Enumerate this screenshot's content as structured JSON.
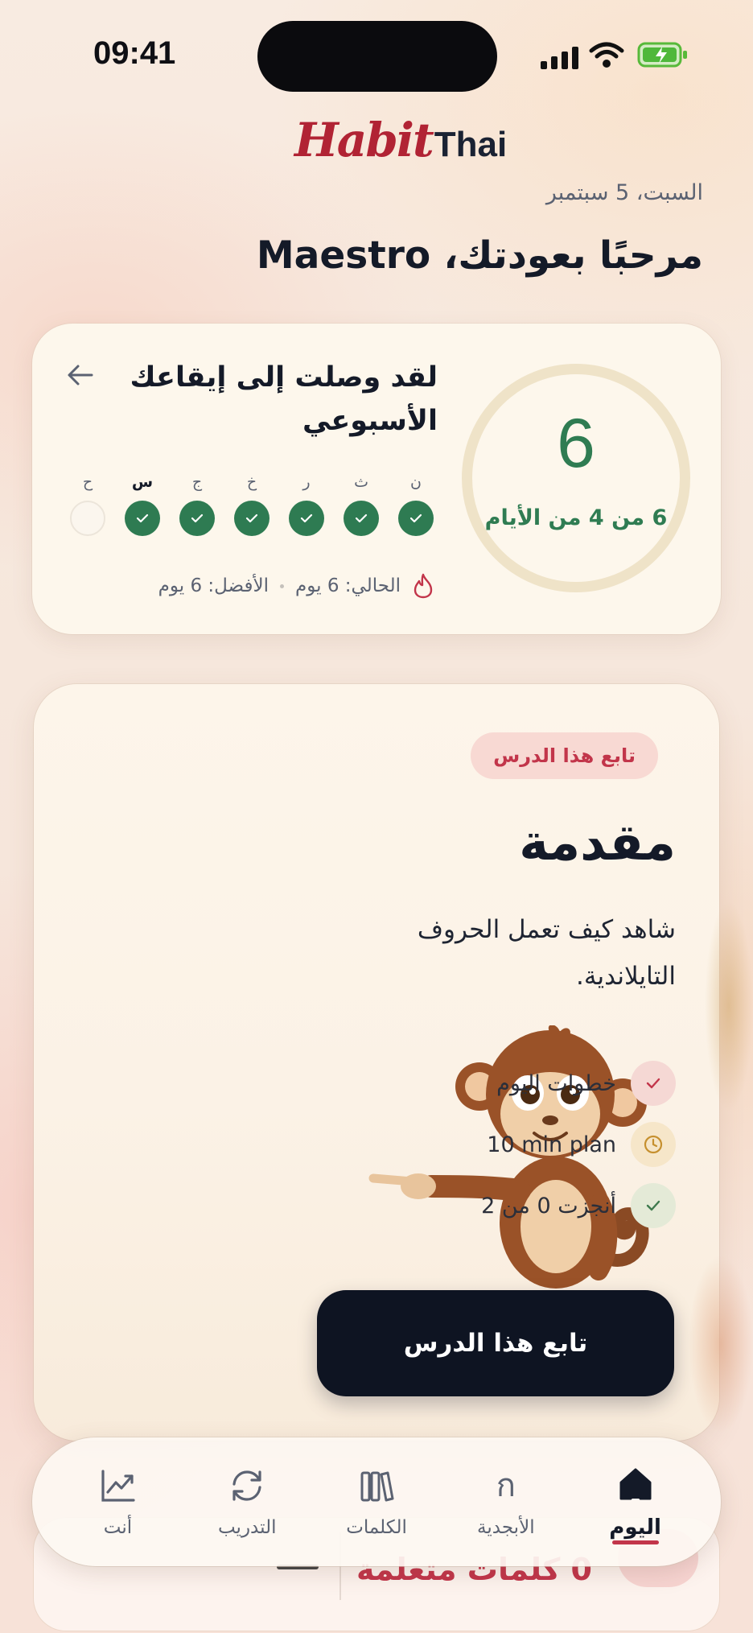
{
  "status": {
    "time": "09:41"
  },
  "header": {
    "logo_script": "Habit",
    "logo_bold": "Thai",
    "date": "السبت، 5 سبتمبر",
    "welcome": "مرحبًا بعودتك، Maestro"
  },
  "streak": {
    "ring_number": "6",
    "ring_caption": "6 من 4 من الأيام",
    "title": "لقد وصلت إلى إيقاعك الأسبوعي",
    "days": [
      {
        "label": "ن",
        "done": true
      },
      {
        "label": "ث",
        "done": true
      },
      {
        "label": "ر",
        "done": true
      },
      {
        "label": "خ",
        "done": true
      },
      {
        "label": "ج",
        "done": true
      },
      {
        "label": "س",
        "done": true
      },
      {
        "label": "ح",
        "done": false
      }
    ],
    "current": "الحالي: 6 يوم",
    "best": "الأفضل: 6 يوم"
  },
  "lesson": {
    "badge": "تابع هذا الدرس",
    "title": "مقدمة",
    "description": "شاهد كيف تعمل الحروف التايلاندية.",
    "rows": [
      {
        "text": "خطوات اليوم",
        "icon": "check-icon"
      },
      {
        "text": "10 min plan",
        "icon": "clock-icon"
      },
      {
        "text": "أنجزت 0 من 2",
        "icon": "check-icon"
      }
    ],
    "cta": "تابع هذا الدرس"
  },
  "learned": {
    "label": "0 كلمات متعلمة"
  },
  "tabs": [
    {
      "label": "اليوم",
      "icon": "home-icon",
      "active": true
    },
    {
      "label": "الأبجدية",
      "icon": "thai-letter-icon",
      "glyph": "ก",
      "active": false
    },
    {
      "label": "الكلمات",
      "icon": "books-icon",
      "active": false
    },
    {
      "label": "التدريب",
      "icon": "refresh-icon",
      "active": false
    },
    {
      "label": "أنت",
      "icon": "chart-icon",
      "active": false
    }
  ],
  "colors": {
    "brand": "#b12334",
    "green": "#2e7b52",
    "dark": "#0e1422"
  }
}
